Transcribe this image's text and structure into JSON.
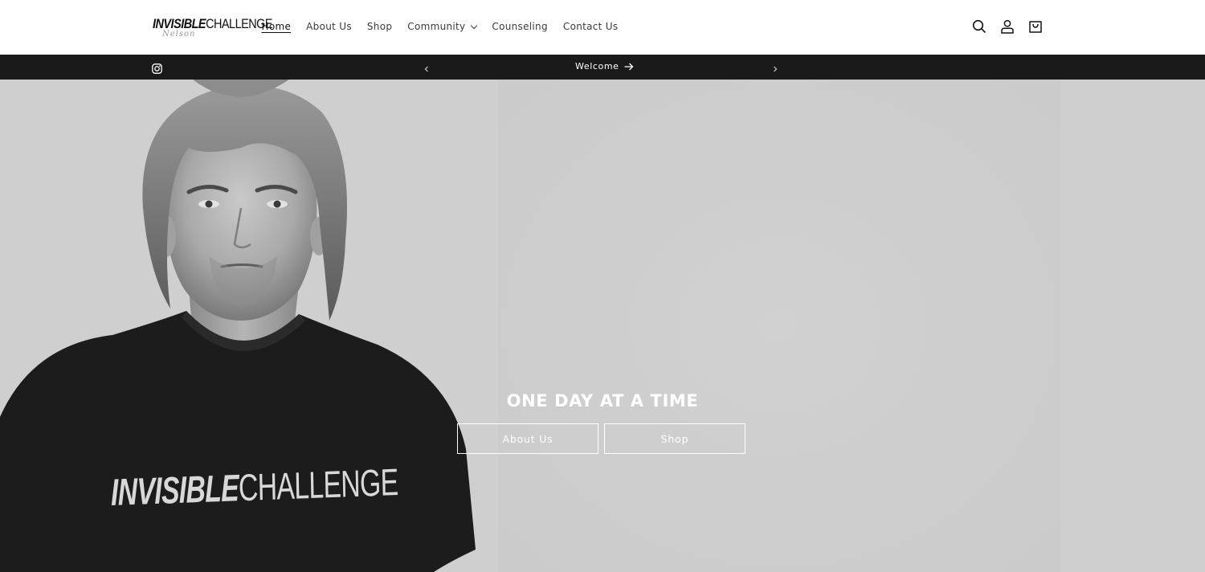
{
  "brand": {
    "logo_primary": "INVISIBLE",
    "logo_secondary": "CHALLENGE",
    "logo_signature": "Nelson"
  },
  "nav": {
    "items": [
      {
        "label": "Home",
        "active": true
      },
      {
        "label": "About Us"
      },
      {
        "label": "Shop"
      },
      {
        "label": "Community",
        "has_dropdown": true
      },
      {
        "label": "Counseling"
      },
      {
        "label": "Contact Us"
      }
    ]
  },
  "header_icons": [
    "search-icon",
    "account-icon",
    "cart-icon"
  ],
  "announcement": {
    "text": "Welcome",
    "social": "instagram-icon"
  },
  "hero": {
    "title": "ONE DAY AT A TIME",
    "buttons": [
      {
        "label": "About Us"
      },
      {
        "label": "Shop"
      }
    ],
    "shirt_logo_primary": "INVISIBLE",
    "shirt_logo_secondary": "CHALLENGE"
  },
  "colors": {
    "announcement_bg": "#1a1a1a",
    "hero_bg": "#cfcfcf",
    "text": "#121212"
  }
}
